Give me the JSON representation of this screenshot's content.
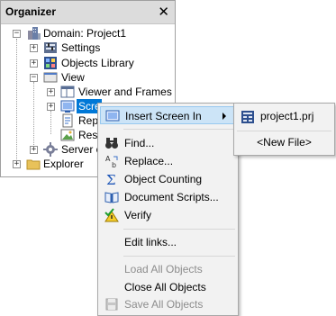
{
  "organizer": {
    "title": "Organizer",
    "close_glyph": "✕",
    "tree": [
      {
        "label": "Domain: Project1",
        "icon": "domain-icon",
        "expander": "−"
      },
      {
        "label": "Settings",
        "icon": "settings-icon",
        "expander": "+"
      },
      {
        "label": "Objects Library",
        "icon": "library-icon",
        "expander": "+"
      },
      {
        "label": "View",
        "icon": "view-icon",
        "expander": "−"
      },
      {
        "label": "Viewer and Frames",
        "icon": "frames-icon",
        "expander": "+"
      },
      {
        "label": "Scree",
        "icon": "screens-icon",
        "expander": "+",
        "selected": true
      },
      {
        "label": "Repo",
        "icon": "reports-icon"
      },
      {
        "label": "Reso",
        "icon": "resources-icon"
      },
      {
        "label": "Server o",
        "icon": "server-icon",
        "expander": "+"
      },
      {
        "label": "Explorer",
        "icon": "folder-icon",
        "expander": "+"
      }
    ]
  },
  "context_menu": {
    "items": [
      {
        "label": "Insert Screen In",
        "icon": "insert-screen-icon",
        "submenu": true,
        "highlighted": true
      },
      {
        "label": "Find...",
        "icon": "binoculars-icon"
      },
      {
        "label": "Replace...",
        "icon": "replace-icon"
      },
      {
        "label": "Object Counting",
        "icon": "sigma-icon"
      },
      {
        "label": "Document Scripts...",
        "icon": "book-icon"
      },
      {
        "label": "Verify",
        "icon": "verify-icon"
      },
      {
        "label": "Edit links..."
      },
      {
        "label": "Load All Objects",
        "disabled": true
      },
      {
        "label": "Close All Objects"
      },
      {
        "label": "Save All Objects",
        "icon": "save-icon",
        "disabled": true
      }
    ]
  },
  "submenu": {
    "items": [
      {
        "label": "project1.prj",
        "icon": "project-file-icon"
      },
      {
        "label": "<New File>"
      }
    ]
  },
  "colors": {
    "selection": "#0078d7",
    "menu_highlight": "#cce4f7",
    "disabled_text": "#8d8d8d"
  }
}
